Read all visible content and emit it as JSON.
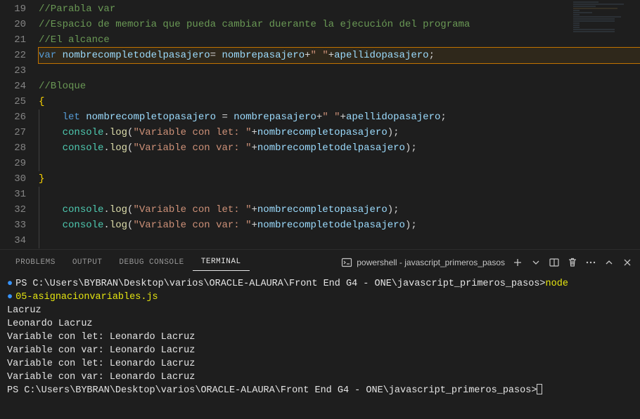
{
  "editor": {
    "lines": [
      {
        "num": 19,
        "indent": 0,
        "highlighted": false,
        "tokens": [
          {
            "cls": "c-comment",
            "t": "//Parabla var"
          }
        ]
      },
      {
        "num": 20,
        "indent": 0,
        "highlighted": false,
        "tokens": [
          {
            "cls": "c-comment",
            "t": "//Espacio de memoria que pueda cambiar duerante la ejecución del programa"
          }
        ]
      },
      {
        "num": 21,
        "indent": 0,
        "highlighted": false,
        "tokens": [
          {
            "cls": "c-comment",
            "t": "//El alcance"
          }
        ]
      },
      {
        "num": 22,
        "indent": 0,
        "highlighted": true,
        "tokens": [
          {
            "cls": "c-keyword",
            "t": "var"
          },
          {
            "cls": "",
            "t": " "
          },
          {
            "cls": "c-var",
            "t": "nombrecompletodelpasajero"
          },
          {
            "cls": "c-punc",
            "t": "= "
          },
          {
            "cls": "c-var",
            "t": "nombrepasajero"
          },
          {
            "cls": "c-punc",
            "t": "+"
          },
          {
            "cls": "c-string",
            "t": "\" \""
          },
          {
            "cls": "c-punc",
            "t": "+"
          },
          {
            "cls": "c-var",
            "t": "apellidopasajero"
          },
          {
            "cls": "c-punc",
            "t": ";"
          }
        ]
      },
      {
        "num": 23,
        "indent": 0,
        "highlighted": false,
        "tokens": []
      },
      {
        "num": 24,
        "indent": 0,
        "highlighted": false,
        "tokens": [
          {
            "cls": "c-comment",
            "t": "//Bloque"
          }
        ]
      },
      {
        "num": 25,
        "indent": 0,
        "highlighted": false,
        "tokens": [
          {
            "cls": "c-brace",
            "t": "{"
          }
        ]
      },
      {
        "num": 26,
        "indent": 1,
        "highlighted": false,
        "tokens": [
          {
            "cls": "",
            "t": "    "
          },
          {
            "cls": "c-keyword",
            "t": "let"
          },
          {
            "cls": "",
            "t": " "
          },
          {
            "cls": "c-var",
            "t": "nombrecompletopasajero"
          },
          {
            "cls": "c-punc",
            "t": " = "
          },
          {
            "cls": "c-var",
            "t": "nombrepasajero"
          },
          {
            "cls": "c-punc",
            "t": "+"
          },
          {
            "cls": "c-string",
            "t": "\" \""
          },
          {
            "cls": "c-punc",
            "t": "+"
          },
          {
            "cls": "c-var",
            "t": "apellidopasajero"
          },
          {
            "cls": "c-punc",
            "t": ";"
          }
        ]
      },
      {
        "num": 27,
        "indent": 1,
        "highlighted": false,
        "tokens": [
          {
            "cls": "",
            "t": "    "
          },
          {
            "cls": "c-obj",
            "t": "console"
          },
          {
            "cls": "c-punc",
            "t": "."
          },
          {
            "cls": "c-func",
            "t": "log"
          },
          {
            "cls": "c-punc",
            "t": "("
          },
          {
            "cls": "c-string",
            "t": "\"Variable con let: \""
          },
          {
            "cls": "c-punc",
            "t": "+"
          },
          {
            "cls": "c-var",
            "t": "nombrecompletopasajero"
          },
          {
            "cls": "c-punc",
            "t": ");"
          }
        ]
      },
      {
        "num": 28,
        "indent": 1,
        "highlighted": false,
        "tokens": [
          {
            "cls": "",
            "t": "    "
          },
          {
            "cls": "c-obj",
            "t": "console"
          },
          {
            "cls": "c-punc",
            "t": "."
          },
          {
            "cls": "c-func",
            "t": "log"
          },
          {
            "cls": "c-punc",
            "t": "("
          },
          {
            "cls": "c-string",
            "t": "\"Variable con var: \""
          },
          {
            "cls": "c-punc",
            "t": "+"
          },
          {
            "cls": "c-var",
            "t": "nombrecompletodelpasajero"
          },
          {
            "cls": "c-punc",
            "t": ");"
          }
        ]
      },
      {
        "num": 29,
        "indent": 1,
        "highlighted": false,
        "tokens": []
      },
      {
        "num": 30,
        "indent": 0,
        "highlighted": false,
        "tokens": [
          {
            "cls": "c-brace",
            "t": "}"
          }
        ]
      },
      {
        "num": 31,
        "indent": 1,
        "highlighted": false,
        "tokens": []
      },
      {
        "num": 32,
        "indent": 1,
        "highlighted": false,
        "tokens": [
          {
            "cls": "",
            "t": "    "
          },
          {
            "cls": "c-obj",
            "t": "console"
          },
          {
            "cls": "c-punc",
            "t": "."
          },
          {
            "cls": "c-func",
            "t": "log"
          },
          {
            "cls": "c-punc",
            "t": "("
          },
          {
            "cls": "c-string",
            "t": "\"Variable con let: \""
          },
          {
            "cls": "c-punc",
            "t": "+"
          },
          {
            "cls": "c-var",
            "t": "nombrecompletopasajero"
          },
          {
            "cls": "c-punc",
            "t": ");"
          }
        ]
      },
      {
        "num": 33,
        "indent": 1,
        "highlighted": false,
        "tokens": [
          {
            "cls": "",
            "t": "    "
          },
          {
            "cls": "c-obj",
            "t": "console"
          },
          {
            "cls": "c-punc",
            "t": "."
          },
          {
            "cls": "c-func",
            "t": "log"
          },
          {
            "cls": "c-punc",
            "t": "("
          },
          {
            "cls": "c-string",
            "t": "\"Variable con var: \""
          },
          {
            "cls": "c-punc",
            "t": "+"
          },
          {
            "cls": "c-var",
            "t": "nombrecompletodelpasajero"
          },
          {
            "cls": "c-punc",
            "t": ");"
          }
        ]
      },
      {
        "num": 34,
        "indent": 1,
        "highlighted": false,
        "tokens": []
      }
    ]
  },
  "panel": {
    "tabs": {
      "problems": "PROBLEMS",
      "output": "OUTPUT",
      "debug": "DEBUG CONSOLE",
      "terminal": "TERMINAL"
    },
    "shell_label": "powershell - javascript_primeros_pasos"
  },
  "terminal": {
    "lines": [
      {
        "bullet": true,
        "segments": [
          {
            "cls": "t-white",
            "t": "PS C:\\Users\\BYBRAN\\Desktop\\varios\\ORACLE-ALAURA\\Front End G4 - ONE\\javascript_primeros_pasos>"
          },
          {
            "cls": "t-yellow",
            "t": "node "
          }
        ]
      },
      {
        "bullet": true,
        "segments": [
          {
            "cls": "t-yellow",
            "t": "05-asignacionvariables.js"
          }
        ]
      },
      {
        "bullet": false,
        "segments": [
          {
            "cls": "t-white",
            "t": "Lacruz"
          }
        ]
      },
      {
        "bullet": false,
        "segments": [
          {
            "cls": "t-white",
            "t": "Leonardo Lacruz"
          }
        ]
      },
      {
        "bullet": false,
        "segments": [
          {
            "cls": "t-white",
            "t": "Variable con let: Leonardo Lacruz"
          }
        ]
      },
      {
        "bullet": false,
        "segments": [
          {
            "cls": "t-white",
            "t": "Variable con var: Leonardo Lacruz"
          }
        ]
      },
      {
        "bullet": false,
        "segments": [
          {
            "cls": "t-white",
            "t": "Variable con let: Leonardo Lacruz"
          }
        ]
      },
      {
        "bullet": false,
        "segments": [
          {
            "cls": "t-white",
            "t": "Variable con var: Leonardo Lacruz"
          }
        ]
      },
      {
        "bullet": false,
        "cursor": true,
        "segments": [
          {
            "cls": "t-white",
            "t": "PS C:\\Users\\BYBRAN\\Desktop\\varios\\ORACLE-ALAURA\\Front End G4 - ONE\\javascript_primeros_pasos>"
          }
        ]
      }
    ]
  }
}
